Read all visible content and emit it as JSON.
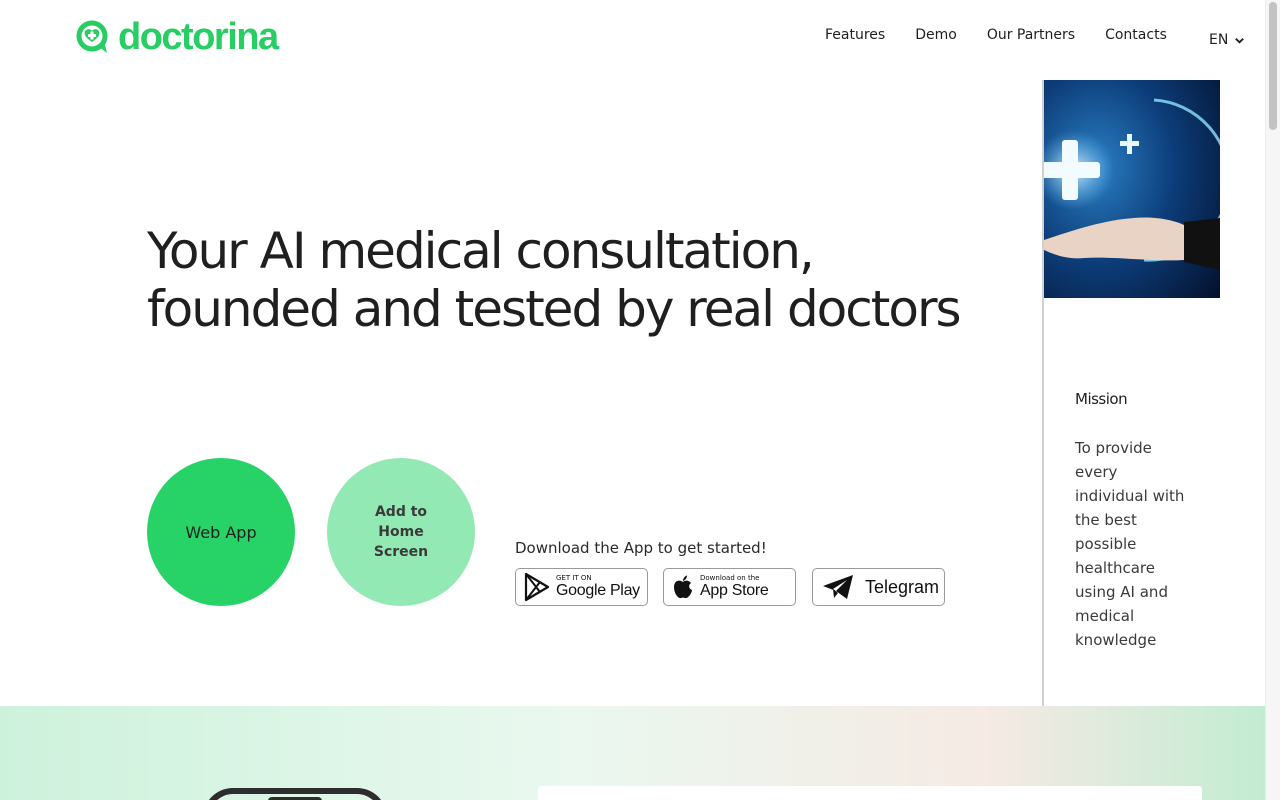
{
  "header": {
    "logo_text": "doctorina",
    "nav": [
      "Features",
      "Demo",
      "Our Partners",
      "Contacts"
    ],
    "language": "EN"
  },
  "hero": {
    "title": "Your AI medical consultation, founded and tested by real doctors",
    "web_app_label": "Web App",
    "add_home_label": "Add to Home Screen",
    "download_text": "Download the App to get started!",
    "google_play": {
      "small": "GET IT ON",
      "big": "Google Play"
    },
    "app_store": {
      "small": "Download on the",
      "big": "App Store"
    },
    "telegram": "Telegram"
  },
  "side": {
    "title": "Mission",
    "text": "To provide every individual with the best possible healthcare using AI and medical knowledge"
  },
  "colors": {
    "brand_green": "#28cd64",
    "light_green": "#93e9b3"
  },
  "icons": [
    "logo-mark-icon",
    "chevron-down-icon",
    "google-play-icon",
    "apple-icon",
    "telegram-icon"
  ]
}
